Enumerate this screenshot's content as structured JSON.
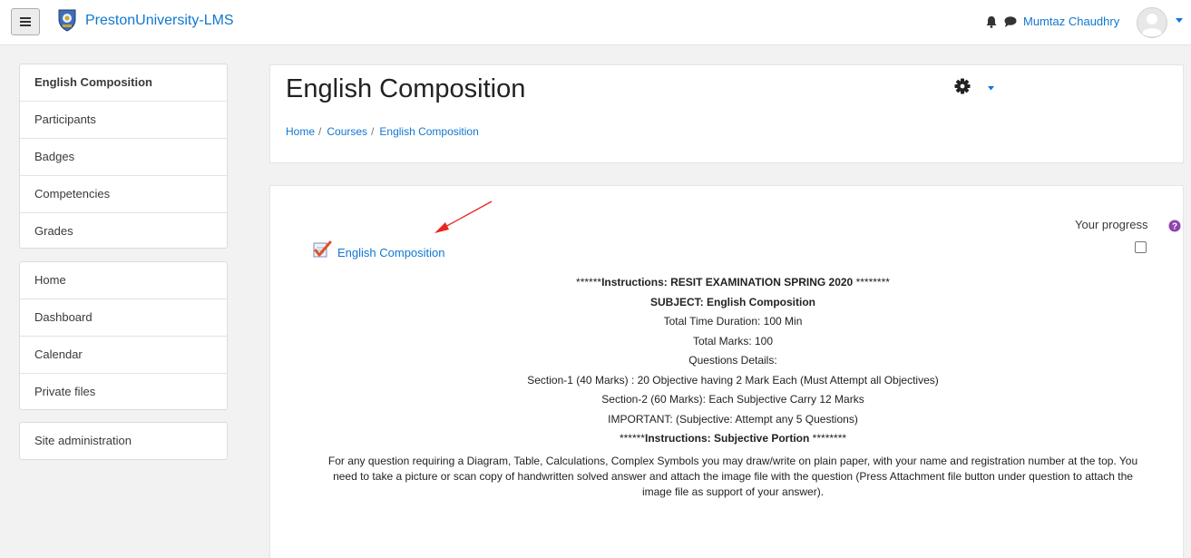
{
  "navbar": {
    "site_name": "PrestonUniversity-LMS",
    "user_name": "Mumtaz Chaudhry",
    "icons": [
      "menu-icon",
      "site-logo",
      "bell-icon",
      "chat-icon",
      "avatar",
      "chevron-down-icon"
    ]
  },
  "sidebar": {
    "course_items": [
      {
        "label": "English Composition",
        "active": true
      },
      {
        "label": "Participants"
      },
      {
        "label": "Badges"
      },
      {
        "label": "Competencies"
      },
      {
        "label": "Grades"
      }
    ],
    "site_items": [
      {
        "label": "Home"
      },
      {
        "label": "Dashboard"
      },
      {
        "label": "Calendar"
      },
      {
        "label": "Private files"
      }
    ],
    "admin_items": [
      {
        "label": "Site administration"
      }
    ]
  },
  "header": {
    "title": "English Composition",
    "breadcrumb": [
      "Home",
      "Courses",
      "English Composition"
    ],
    "separator": "/"
  },
  "main": {
    "progress_label": "Your progress",
    "activity_link": "English Composition",
    "instructions": {
      "heading_prefix": "******",
      "heading_text": "Instructions: RESIT EXAMINATION SPRING 2020",
      "heading_suffix": " ********",
      "subject": "SUBJECT:  English Composition",
      "time": "Total Time Duration: 100 Min",
      "marks": "Total Marks: 100",
      "details": "Questions Details:",
      "section1": "Section-1 (40 Marks) : 20 Objective having 2 Mark Each (Must Attempt all Objectives)",
      "section2": "Section-2 (60 Marks): Each Subjective Carry 12 Marks",
      "important": "IMPORTANT: (Subjective: Attempt any 5 Questions)",
      "sub_prefix": "******",
      "sub_text": "Instructions: Subjective Portion",
      "sub_suffix": " ********",
      "paragraph": "For any question requiring a Diagram, Table, Calculations, Complex Symbols you may draw/write on plain paper, with your name and registration number at the top. You need to take a picture or scan copy of handwritten solved answer and attach the image file with the question (Press Attachment file button under question to attach the image file as support of your answer)."
    }
  },
  "colors": {
    "link": "#1177d1",
    "annotation_arrow": "#e8261d",
    "help_icon": "#8e44ad"
  }
}
